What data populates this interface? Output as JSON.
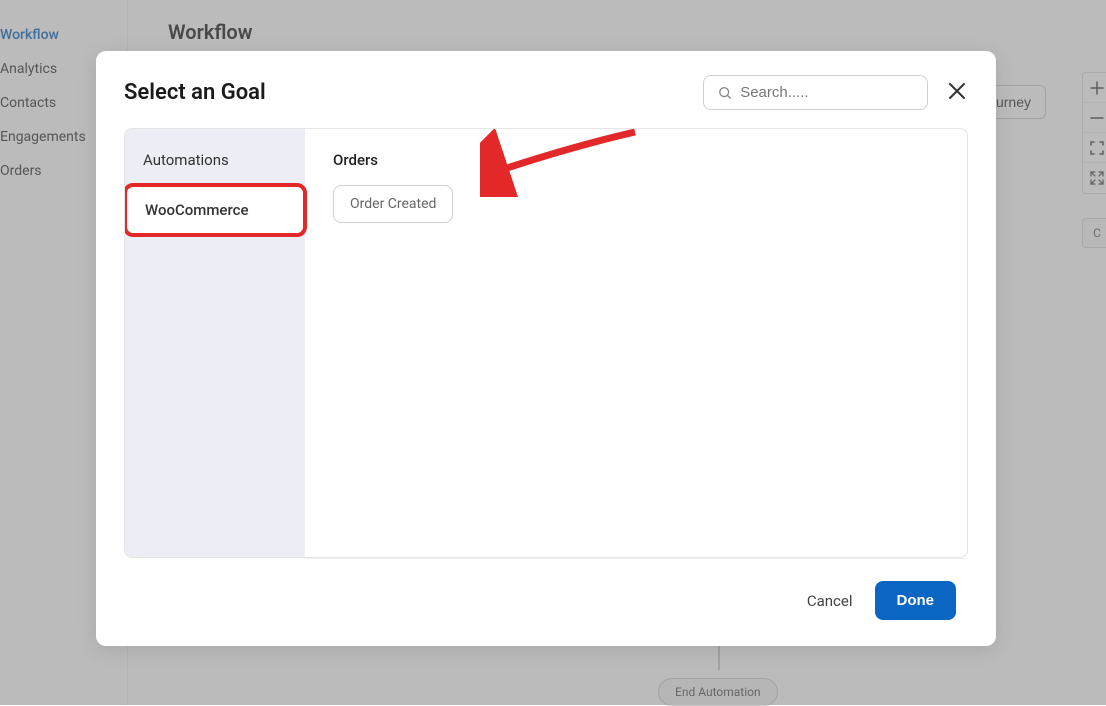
{
  "leftNav": {
    "items": [
      {
        "label": "Workflow",
        "active": true
      },
      {
        "label": "Analytics"
      },
      {
        "label": "Contacts"
      },
      {
        "label": "Engagements"
      },
      {
        "label": "Orders"
      }
    ]
  },
  "page": {
    "title": "Workflow",
    "journeyButton": "Journey"
  },
  "canvas": {
    "endNode": "End Automation",
    "sideTab": "C"
  },
  "modal": {
    "title": "Select an Goal",
    "searchPlaceholder": "Search.....",
    "categories": [
      {
        "label": "Automations"
      },
      {
        "label": "WooCommerce",
        "selected": true
      }
    ],
    "sectionTitle": "Orders",
    "chips": [
      {
        "label": "Order Created"
      }
    ],
    "cancel": "Cancel",
    "done": "Done"
  }
}
